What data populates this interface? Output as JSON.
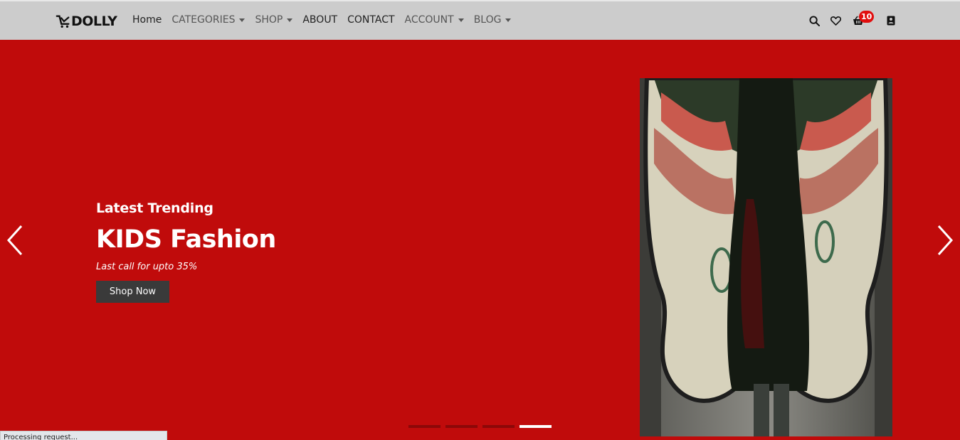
{
  "brand": {
    "name": "DOLLY"
  },
  "nav": {
    "items": [
      {
        "label": "Home",
        "dropdown": false
      },
      {
        "label": "CATEGORIES",
        "dropdown": true
      },
      {
        "label": "SHOP",
        "dropdown": true
      },
      {
        "label": "ABOUT",
        "dropdown": false
      },
      {
        "label": "CONTACT",
        "dropdown": false
      },
      {
        "label": "ACCOUNT",
        "dropdown": true
      },
      {
        "label": "BLOG",
        "dropdown": true
      }
    ]
  },
  "icons": {
    "search": "search-icon",
    "wishlist": "heart-icon",
    "cart": "basket-icon",
    "account": "account-icon"
  },
  "cart": {
    "count": "10"
  },
  "hero": {
    "subtitle": "Latest Trending",
    "title": "KIDS Fashion",
    "description": "Last call for upto 35%",
    "cta_label": "Shop Now",
    "background_color": "#c00b0b"
  },
  "carousel": {
    "slides": 4,
    "active_index": 3
  },
  "status": {
    "text": "Processing request..."
  }
}
